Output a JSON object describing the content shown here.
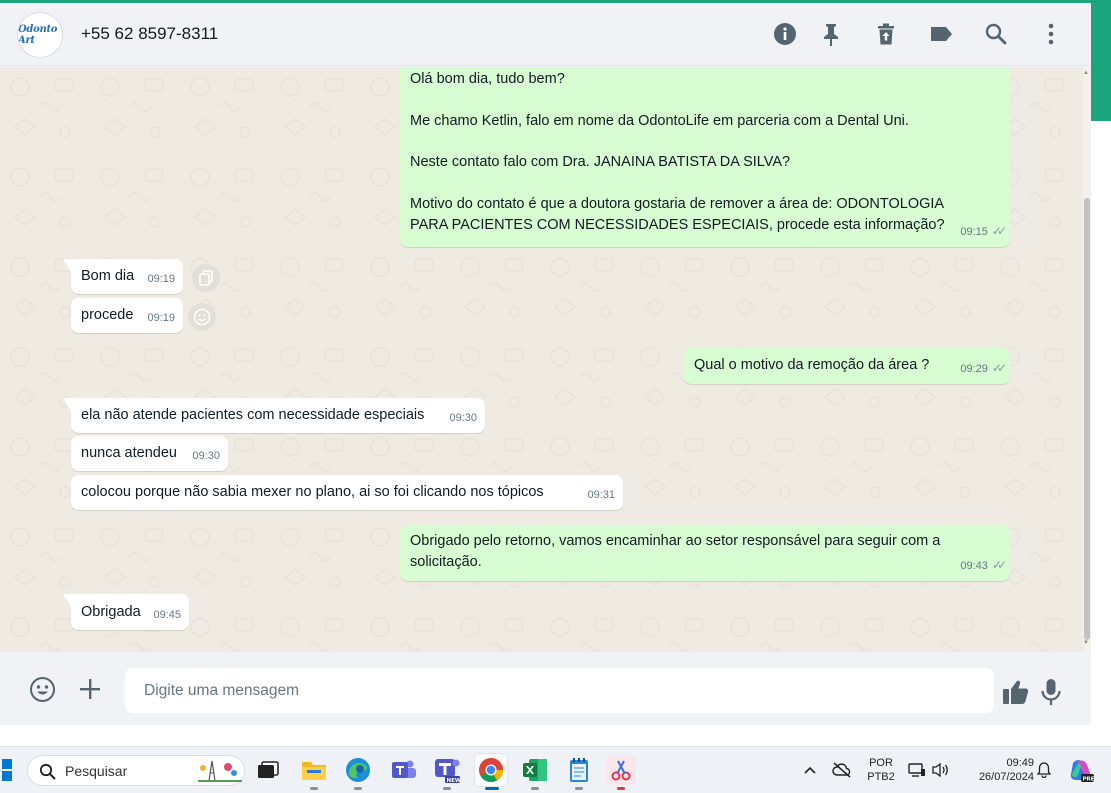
{
  "header": {
    "avatar_text": "Odonto Art",
    "contact_name": "+55 62 8597-8311",
    "icons": [
      "info-icon",
      "pin-icon",
      "trash-icon",
      "label-icon",
      "search-icon",
      "menu-icon"
    ]
  },
  "messages": [
    {
      "direction": "out",
      "lines": [
        "Olá bom dia, tudo bem?",
        "",
        "Me chamo Ketlin, falo em nome da OdontoLife em parceria com a Dental Uni.",
        "",
        "Neste contato falo com Dra. JANAINA BATISTA DA SILVA?",
        "",
        "Motivo do contato é que a doutora gostaria de remover a área de: ODONTOLOGIA",
        "PARA PACIENTES COM NECESSIDADES ESPECIAIS, procede esta informação?"
      ],
      "time": "09:15",
      "status": "read"
    },
    {
      "direction": "in",
      "text": "Bom dia",
      "time": "09:19"
    },
    {
      "direction": "in",
      "text": "procede",
      "time": "09:19"
    },
    {
      "direction": "out",
      "text": "Qual o motivo da remoção da área ?",
      "time": "09:29",
      "status": "read"
    },
    {
      "direction": "in",
      "text": "ela não atende pacientes com necessidade especiais",
      "time": "09:30"
    },
    {
      "direction": "in",
      "text": "nunca atendeu",
      "time": "09:30"
    },
    {
      "direction": "in",
      "text": "colocou porque não sabia mexer no plano, ai so foi clicando nos tópicos",
      "time": "09:31"
    },
    {
      "direction": "out",
      "lines": [
        "Obrigado pelo retorno, vamos encaminhar ao setor responsável para seguir com a",
        "solicitação."
      ],
      "time": "09:43",
      "status": "read"
    },
    {
      "direction": "in",
      "text": "Obrigada",
      "time": "09:45"
    }
  ],
  "composer": {
    "placeholder": "Digite uma mensagem",
    "icons": [
      "emoji-icon",
      "plus-icon",
      "thumbs-up-icon",
      "microphone-icon"
    ]
  },
  "taskbar": {
    "search_label": "Pesquisar",
    "language_top": "POR",
    "language_bottom": "PTB2",
    "clock_time": "09:49",
    "clock_date": "26/07/2024",
    "apps": [
      "windows-start",
      "task-view",
      "file-explorer",
      "edge",
      "teams",
      "teams-new",
      "chrome",
      "excel",
      "notepad",
      "snipping-tool"
    ]
  },
  "colors": {
    "outgoing_bubble": "#d9fdd3",
    "incoming_bubble": "#ffffff",
    "chat_background": "#efeae2",
    "accent": "#1aa57e"
  }
}
